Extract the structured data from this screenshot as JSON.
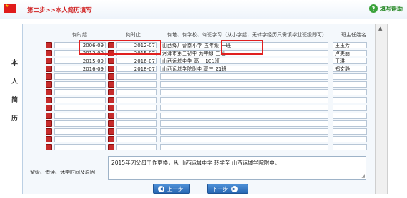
{
  "header": {
    "step_title": "第二步>>本人简历填写",
    "help_label": "填写帮助",
    "flag_stars": "★"
  },
  "columns": {
    "start": "何时起",
    "end": "何时止",
    "school": "何地、何学校、何班学习（从小学起，无转学经历只需填毕业班级即可）",
    "teacher": "班主任姓名"
  },
  "side_label": [
    "本",
    "人",
    "简",
    "历"
  ],
  "rows": [
    {
      "start": "2006-09",
      "end": "2012-07",
      "school": "山西绛厂营南小学",
      "class": "五年级 一班",
      "teacher": "王玉芳"
    },
    {
      "start": "2013-09",
      "end": "2015-07",
      "school": "河津市第三初中 九年级 三班",
      "class": "",
      "teacher": "卢美丽"
    },
    {
      "start": "2015-09",
      "end": "2016-07",
      "school": "山西运城中学 高一 101班",
      "class": "",
      "teacher": "王琪"
    },
    {
      "start": "2016-09",
      "end": "2018-07",
      "school": "山西运城学院附中 高三 21班",
      "class": "",
      "teacher": "郑文静"
    },
    {
      "start": "",
      "end": "",
      "school": "",
      "class": "",
      "teacher": ""
    },
    {
      "start": "",
      "end": "",
      "school": "",
      "class": "",
      "teacher": ""
    },
    {
      "start": "",
      "end": "",
      "school": "",
      "class": "",
      "teacher": ""
    },
    {
      "start": "",
      "end": "",
      "school": "",
      "class": "",
      "teacher": ""
    },
    {
      "start": "",
      "end": "",
      "school": "",
      "class": "",
      "teacher": ""
    },
    {
      "start": "",
      "end": "",
      "school": "",
      "class": "",
      "teacher": ""
    },
    {
      "start": "",
      "end": "",
      "school": "",
      "class": "",
      "teacher": ""
    },
    {
      "start": "",
      "end": "",
      "school": "",
      "class": "",
      "teacher": ""
    },
    {
      "start": "",
      "end": "",
      "school": "",
      "class": "",
      "teacher": ""
    },
    {
      "start": "",
      "end": "",
      "school": "",
      "class": "",
      "teacher": ""
    }
  ],
  "reason": {
    "label": "留级、借读、休学时间及原因",
    "value": "2015年因父母工作更换，从 山西运城中学 转学至  山西运城学院附中。"
  },
  "buttons": {
    "prev": "上一步",
    "next": "下一步",
    "prev_icon": "◀",
    "next_icon": "▶"
  },
  "scroll_icon": "▲"
}
